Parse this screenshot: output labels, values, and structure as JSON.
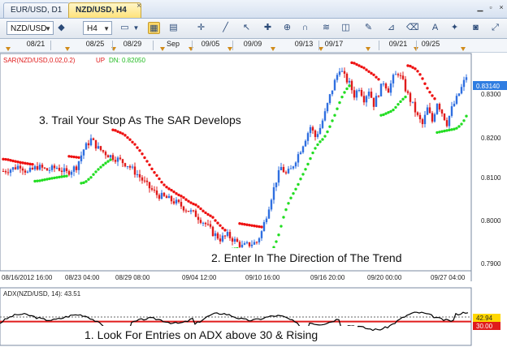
{
  "tabs": [
    {
      "label": "EUR/USD, D1",
      "active": false
    },
    {
      "label": "NZD/USD, H4",
      "active": true
    }
  ],
  "toolbar": {
    "symbol": "NZD/USD",
    "timeframe": "H4",
    "icons": [
      "plus-icon",
      "chart-type-icon",
      "grid-icon",
      "zoom-in-icon",
      "zoom-out-icon",
      "crosshair-icon",
      "candles-icon",
      "autoscroll-icon",
      "indicators-icon",
      "properties-icon",
      "line-tool-icon",
      "cursor-icon",
      "cross-icon",
      "magnet-icon",
      "ruler-icon",
      "text-icon",
      "fib-icon",
      "alert-icon",
      "camera-icon",
      "pencil-icon",
      "eraser-icon",
      "measure-icon",
      "fullscreen-icon"
    ]
  },
  "date_strip": {
    "labels": [
      "08/21",
      "08/25",
      "08/29",
      "Sep",
      "09/05",
      "09/09",
      "09/13",
      "09/17",
      "09/21",
      "09/25"
    ]
  },
  "colors": {
    "bull": "#2f6fe0",
    "bear": "#e01b1b",
    "sar_up": "#22dd22",
    "sar_down": "#ee1111",
    "adx_line": "#000000",
    "adx_level": "#e01b1b",
    "price_tag_bg": "#2f7de1"
  },
  "annotations": {
    "trail": "3. Trail Your Stop As The SAR Develops",
    "enter": "2. Enter In The Direction of The Trend",
    "look": "1. Look For Entries on ADX above 30 & Rising"
  },
  "chart_data": [
    {
      "type": "candlestick",
      "indicator_label": "SAR(NZD/USD,0.02,0.2)",
      "indicator_state": "UP",
      "indicator_value_label": "DN: 0.82050",
      "ylim": [
        0.7885,
        0.8355
      ],
      "y_ticks": [
        "0.8300",
        "0.8200",
        "0.8100",
        "0.8000",
        "0.7900"
      ],
      "current_price": "0.83140",
      "x_ticks": [
        "08/16/2012 16:00",
        "08/23 04:00",
        "08/29 08:00",
        "09/04 12:00",
        "09/10 16:00",
        "09/16 20:00",
        "09/20 00:00",
        "09/27 04:00"
      ],
      "close_path": [
        [
          0,
          0.8102
        ],
        [
          8,
          0.8108
        ],
        [
          14,
          0.8115
        ],
        [
          20,
          0.8098
        ],
        [
          28,
          0.8112
        ],
        [
          36,
          0.8104
        ],
        [
          44,
          0.811
        ],
        [
          52,
          0.8098
        ],
        [
          60,
          0.8112
        ],
        [
          66,
          0.815
        ],
        [
          72,
          0.8172
        ],
        [
          78,
          0.8152
        ],
        [
          86,
          0.8138
        ],
        [
          94,
          0.8128
        ],
        [
          102,
          0.8116
        ],
        [
          110,
          0.8095
        ],
        [
          118,
          0.807
        ],
        [
          126,
          0.805
        ],
        [
          134,
          0.8042
        ],
        [
          142,
          0.8032
        ],
        [
          150,
          0.8018
        ],
        [
          158,
          0.8005
        ],
        [
          166,
          0.7985
        ],
        [
          172,
          0.7965
        ],
        [
          178,
          0.7952
        ],
        [
          184,
          0.796
        ],
        [
          190,
          0.7948
        ],
        [
          196,
          0.7935
        ],
        [
          202,
          0.794
        ],
        [
          208,
          0.7945
        ],
        [
          212,
          0.7968
        ],
        [
          216,
          0.8005
        ],
        [
          220,
          0.8045
        ],
        [
          224,
          0.8082
        ],
        [
          228,
          0.811
        ],
        [
          232,
          0.8095
        ],
        [
          236,
          0.8105
        ],
        [
          240,
          0.8128
        ],
        [
          244,
          0.815
        ],
        [
          248,
          0.8175
        ],
        [
          252,
          0.82
        ],
        [
          256,
          0.8178
        ],
        [
          260,
          0.8198
        ],
        [
          264,
          0.823
        ],
        [
          268,
          0.8268
        ],
        [
          272,
          0.83
        ],
        [
          276,
          0.833
        ],
        [
          280,
          0.831
        ],
        [
          284,
          0.8295
        ],
        [
          288,
          0.827
        ],
        [
          292,
          0.8288
        ],
        [
          296,
          0.8262
        ],
        [
          300,
          0.8282
        ],
        [
          304,
          0.825
        ],
        [
          308,
          0.8275
        ],
        [
          312,
          0.83
        ],
        [
          316,
          0.8282
        ],
        [
          320,
          0.8308
        ],
        [
          324,
          0.832
        ],
        [
          328,
          0.8298
        ],
        [
          332,
          0.827
        ],
        [
          336,
          0.8248
        ],
        [
          340,
          0.8222
        ],
        [
          344,
          0.8205
        ],
        [
          348,
          0.824
        ],
        [
          352,
          0.8212
        ],
        [
          356,
          0.8255
        ],
        [
          360,
          0.8232
        ],
        [
          364,
          0.8208
        ],
        [
          368,
          0.824
        ],
        [
          372,
          0.8262
        ],
        [
          376,
          0.8286
        ],
        [
          380,
          0.8312
        ]
      ]
    },
    {
      "type": "line",
      "indicator_label": "ADX(NZD/USD, 14): 43.51",
      "level": 30,
      "current": 42.94,
      "level_label": "30.00",
      "current_label": "42.94"
    }
  ]
}
